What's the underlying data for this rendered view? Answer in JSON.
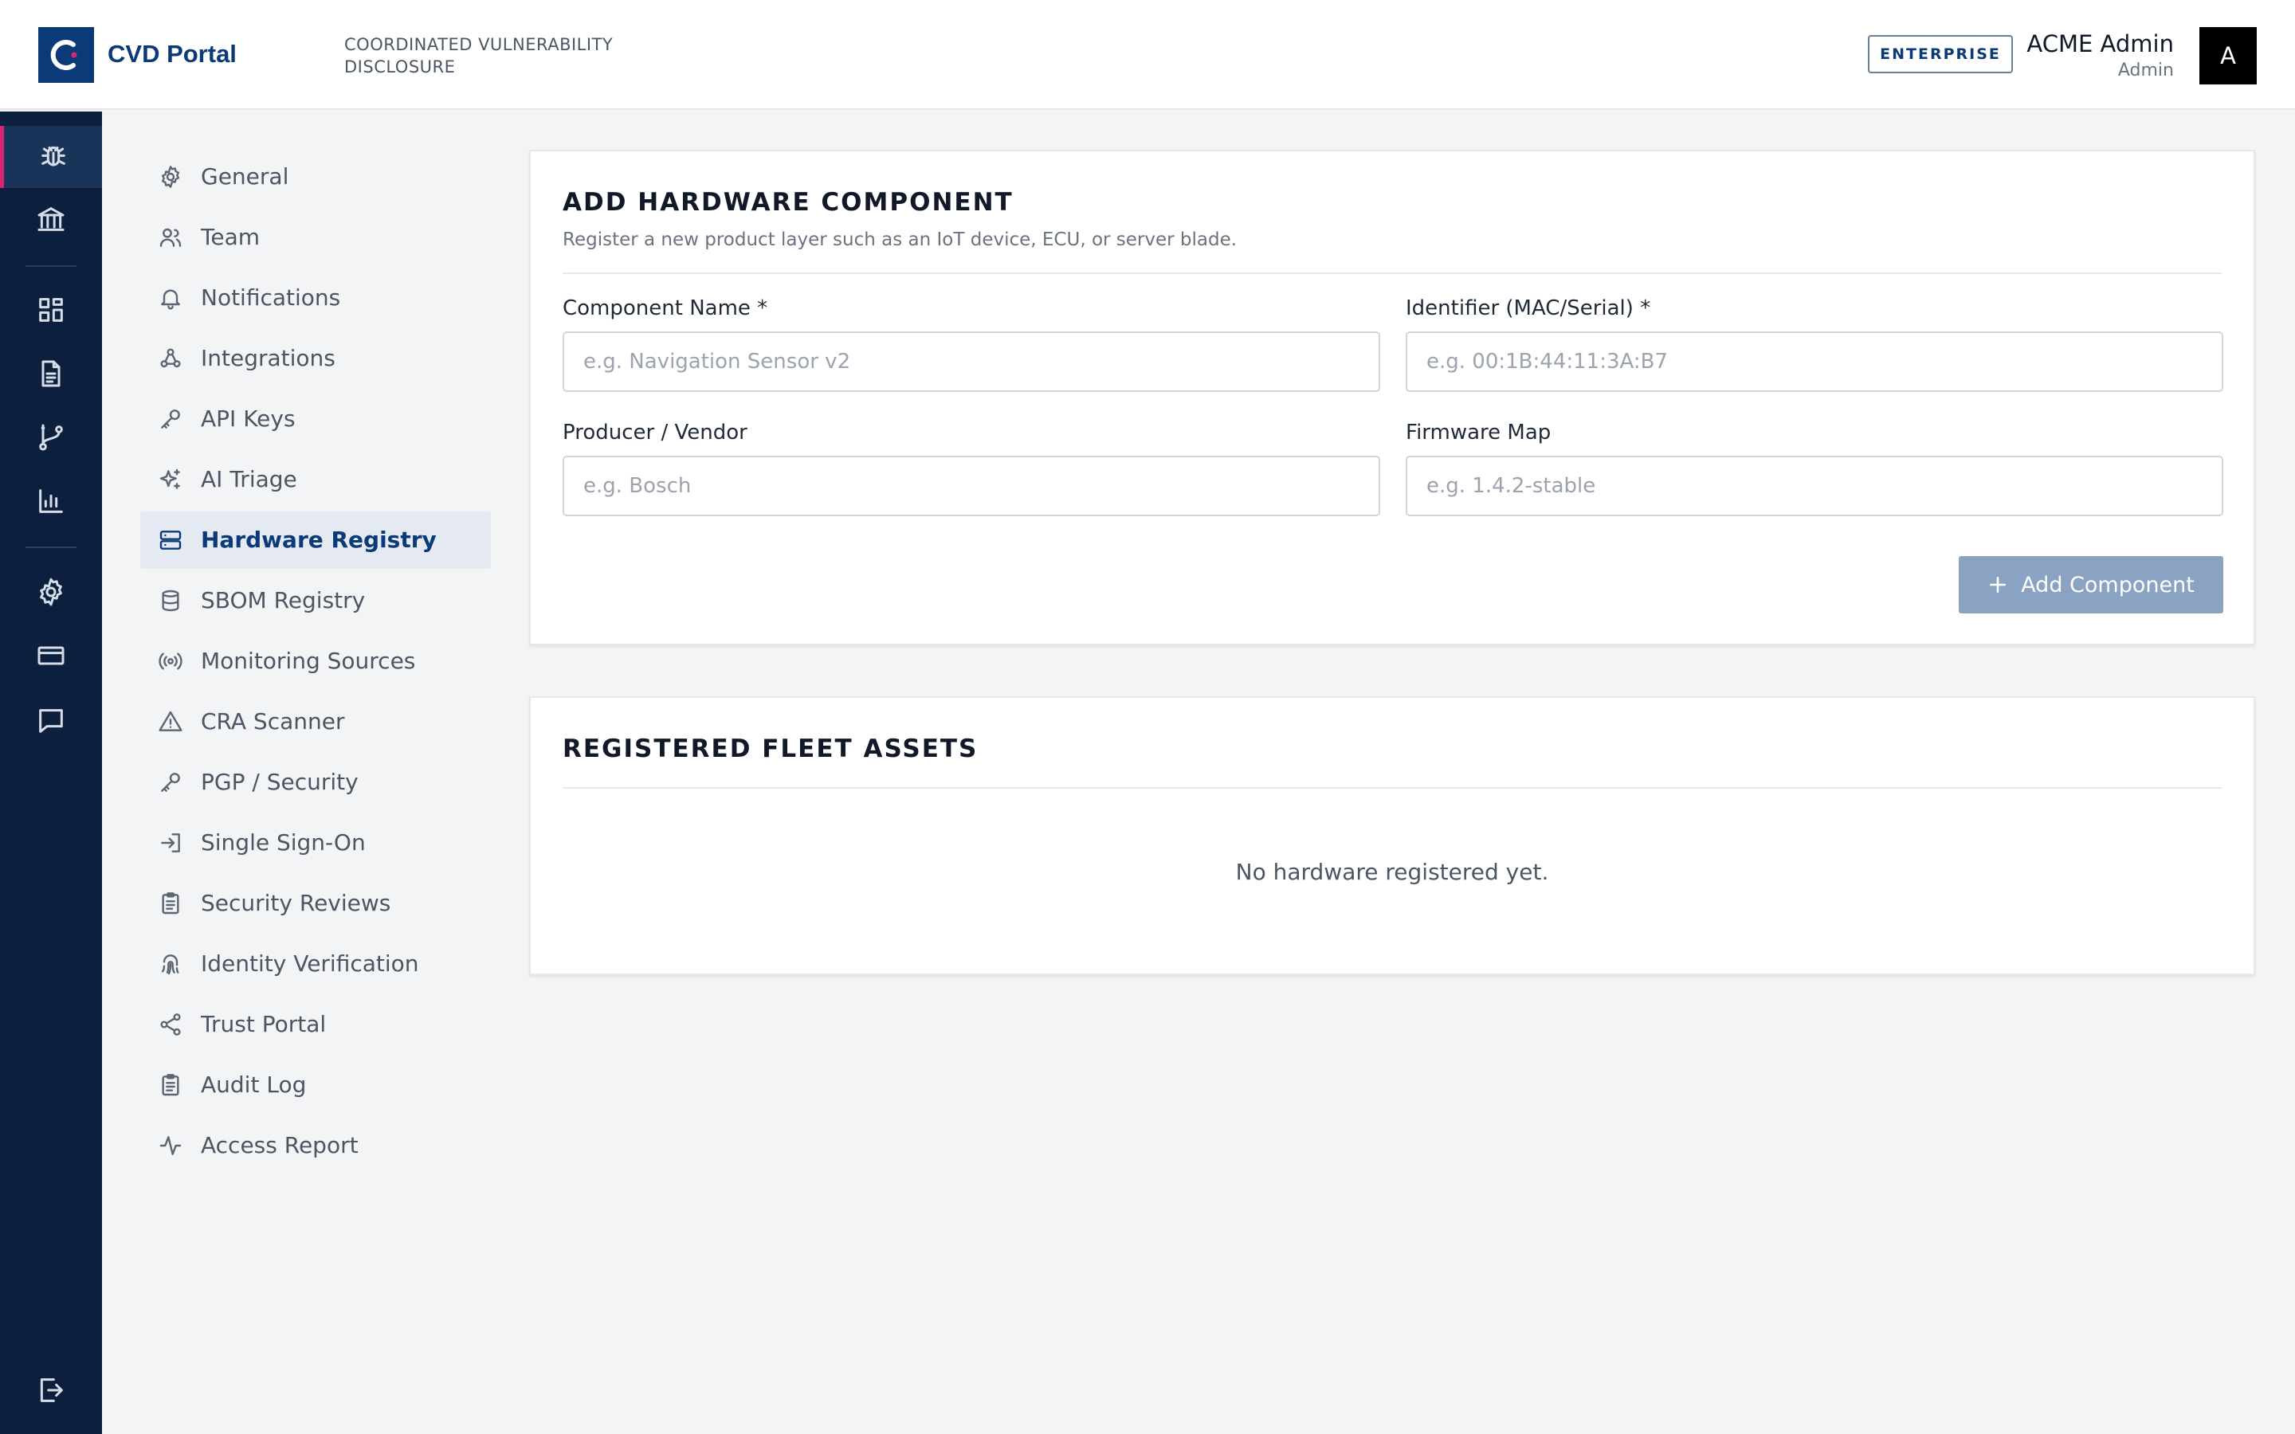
{
  "header": {
    "app_name": "CVD Portal",
    "tagline": "COORDINATED VULNERABILITY DISCLOSURE",
    "plan_badge": "ENTERPRISE",
    "user_name": "ACME Admin",
    "user_role": "Admin",
    "avatar_initial": "A"
  },
  "rail": {
    "items": [
      {
        "icon": "bug-icon",
        "active": true
      },
      {
        "icon": "bank-icon",
        "active": false
      },
      {
        "icon": "dashboard-icon",
        "active": false
      },
      {
        "icon": "document-icon",
        "active": false
      },
      {
        "icon": "git-branch-icon",
        "active": false
      },
      {
        "icon": "bar-chart-icon",
        "active": false
      },
      {
        "icon": "gear-icon",
        "active": false
      },
      {
        "icon": "credit-card-icon",
        "active": false
      },
      {
        "icon": "message-icon",
        "active": false
      },
      {
        "icon": "logout-icon",
        "active": false
      }
    ]
  },
  "settings_nav": {
    "items": [
      {
        "label": "General",
        "icon": "gear-icon"
      },
      {
        "label": "Team",
        "icon": "users-icon"
      },
      {
        "label": "Notifications",
        "icon": "bell-icon"
      },
      {
        "label": "Integrations",
        "icon": "webhook-icon"
      },
      {
        "label": "API Keys",
        "icon": "key-icon"
      },
      {
        "label": "AI Triage",
        "icon": "sparkles-icon"
      },
      {
        "label": "Hardware Registry",
        "icon": "server-icon",
        "active": true
      },
      {
        "label": "SBOM Registry",
        "icon": "database-icon"
      },
      {
        "label": "Monitoring Sources",
        "icon": "radio-icon"
      },
      {
        "label": "CRA Scanner",
        "icon": "warning-icon"
      },
      {
        "label": "PGP / Security",
        "icon": "key-icon"
      },
      {
        "label": "Single Sign-On",
        "icon": "sign-in-icon"
      },
      {
        "label": "Security Reviews",
        "icon": "clipboard-icon"
      },
      {
        "label": "Identity Verification",
        "icon": "fingerprint-icon"
      },
      {
        "label": "Trust Portal",
        "icon": "share-icon"
      },
      {
        "label": "Audit Log",
        "icon": "clipboard-icon"
      },
      {
        "label": "Access Report",
        "icon": "activity-icon"
      }
    ]
  },
  "add_component": {
    "title": "ADD HARDWARE COMPONENT",
    "subtitle": "Register a new product layer such as an IoT device, ECU, or server blade.",
    "fields": {
      "name": {
        "label": "Component Name *",
        "placeholder": "e.g. Navigation Sensor v2",
        "value": ""
      },
      "identifier": {
        "label": "Identifier (MAC/Serial) *",
        "placeholder": "e.g. 00:1B:44:11:3A:B7",
        "value": ""
      },
      "vendor": {
        "label": "Producer / Vendor",
        "placeholder": "e.g. Bosch",
        "value": ""
      },
      "firmware": {
        "label": "Firmware Map",
        "placeholder": "e.g. 1.4.2-stable",
        "value": ""
      }
    },
    "submit_label": "Add Component"
  },
  "fleet_assets": {
    "title": "REGISTERED FLEET ASSETS",
    "empty_message": "No hardware registered yet."
  },
  "colors": {
    "rail_bg": "#0c1f3d",
    "brand_blue": "#0b3a78",
    "active_accent": "#d9256f",
    "button_disabled": "#8aa3c3",
    "page_bg": "#f3f4f6"
  }
}
